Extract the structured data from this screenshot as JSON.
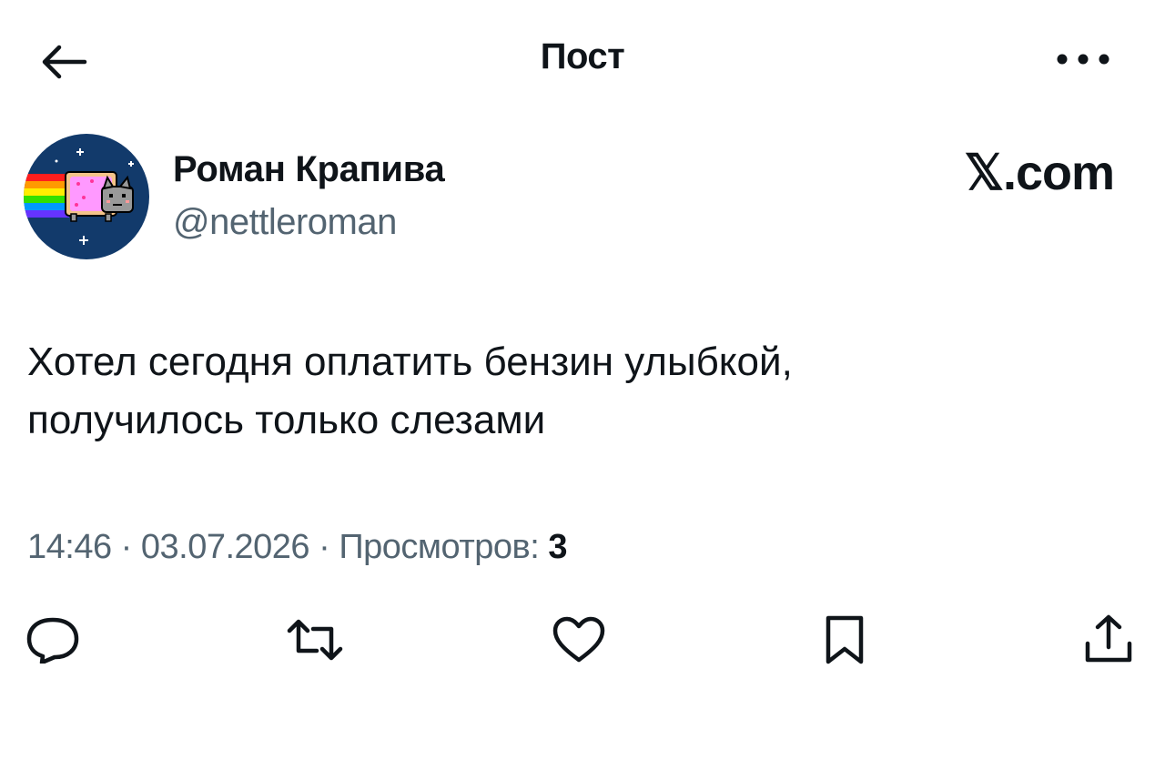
{
  "header": {
    "title": "Пост",
    "back_icon": "arrow-left-icon",
    "more_icon": "more-horizontal-icon"
  },
  "author": {
    "name": "Роман Крапива",
    "handle": "@nettleroman",
    "avatar_icon": "nyan-cat-avatar"
  },
  "watermark": "𝕏.com",
  "post": {
    "text": "Хотел сегодня оплатить бензин улыбкой,\nполучилось только слезами"
  },
  "meta": {
    "time": "14:46",
    "separator": " · ",
    "date": "03.07.2026",
    "views_label": "Просмотров:",
    "views_count": "3"
  },
  "actions": [
    {
      "name": "reply",
      "icon": "reply-icon"
    },
    {
      "name": "repost",
      "icon": "repost-icon"
    },
    {
      "name": "like",
      "icon": "heart-icon"
    },
    {
      "name": "bookmark",
      "icon": "bookmark-icon"
    },
    {
      "name": "share",
      "icon": "share-icon"
    }
  ],
  "colors": {
    "text": "#0f1419",
    "secondary": "#536471",
    "avatar_bg": "#123a6b"
  }
}
